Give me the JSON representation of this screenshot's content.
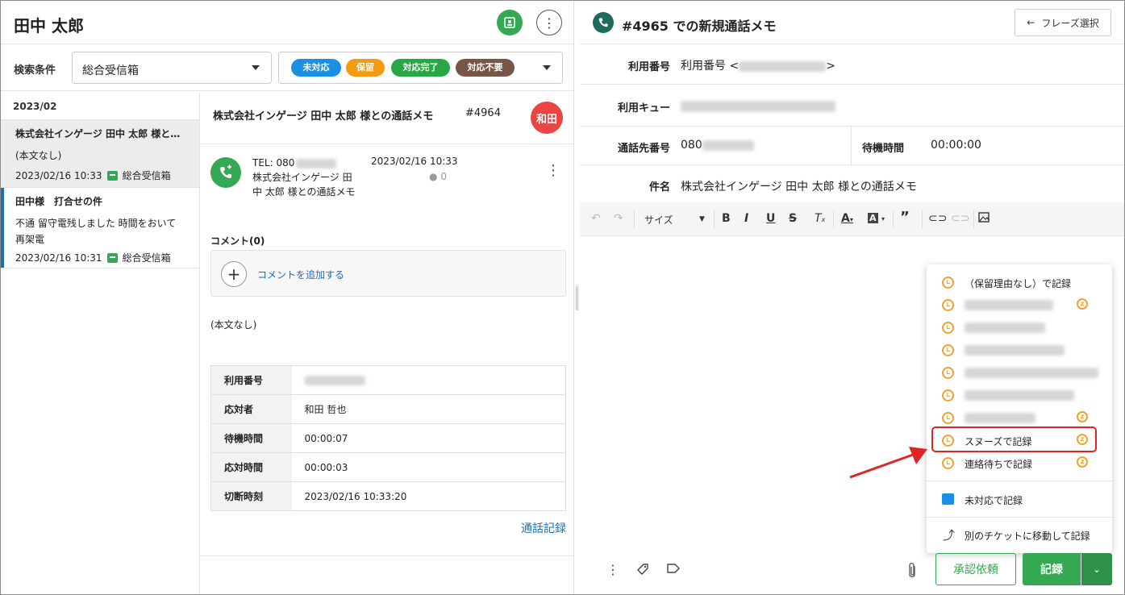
{
  "contact": {
    "name": "田中 太郎"
  },
  "filter": {
    "label": "検索条件",
    "inbox": "総合受信箱",
    "statuses": [
      {
        "label": "未対応",
        "color": "#1a8fe3"
      },
      {
        "label": "保留",
        "color": "#f39c12"
      },
      {
        "label": "対応完了",
        "color": "#27a845"
      },
      {
        "label": "対応不要",
        "color": "#795548"
      }
    ]
  },
  "ticket_list": {
    "month": "2023/02",
    "items": [
      {
        "title": "株式会社インゲージ 田中 太郎 様と…",
        "body": "(本文なし)",
        "date": "2023/02/16 10:33",
        "inbox": "総合受信箱"
      },
      {
        "title": "田中様　打合せの件",
        "body": "不通 留守電残しました 時間をおいて再架電",
        "date": "2023/02/16 10:31",
        "inbox": "総合受信箱"
      }
    ]
  },
  "detail": {
    "title": "株式会社インゲージ 田中 太郎 様との通話メモ",
    "number": "#4964",
    "assignee": "和田",
    "tel": "TEL: 080",
    "call_subject": "株式会社インゲージ 田中 太郎 様との通話メモ",
    "datetime": "2023/02/16 10:33",
    "comments_count": "0",
    "comment_label": "コメント(0)",
    "add_comment": "コメントを追加する",
    "body": "(本文なし)",
    "table": [
      {
        "key": "利用番号",
        "value": ""
      },
      {
        "key": "応対者",
        "value": "和田 哲也"
      },
      {
        "key": "待機時間",
        "value": "00:00:07"
      },
      {
        "key": "応対時間",
        "value": "00:00:03"
      },
      {
        "key": "切断時刻",
        "value": "2023/02/16 10:33:20"
      }
    ],
    "call_log": "通話記録"
  },
  "memo": {
    "title": "#4965 での新規通話メモ",
    "phrase_button": "フレーズ選択",
    "fields": {
      "number_label": "利用番号",
      "number_value_prefix": "利用番号 <",
      "number_value_suffix": ">",
      "queue_label": "利用キュー",
      "dest_label": "通話先番号",
      "dest_value": "080",
      "wait_label": "待機時間",
      "wait_value": "00:00:00",
      "subject_label": "件名",
      "subject_value": "株式会社インゲージ 田中 太郎 様との通話メモ"
    },
    "toolbar": {
      "size_label": "サイズ"
    }
  },
  "record_menu": {
    "items": [
      {
        "label": "（保留理由なし）で記録",
        "alarm": false
      },
      {
        "label": "",
        "alarm": true
      },
      {
        "label": "",
        "alarm": false
      },
      {
        "label": "",
        "alarm": false
      },
      {
        "label": "",
        "alarm": false
      },
      {
        "label": "",
        "alarm": false
      },
      {
        "label": "",
        "alarm": true
      },
      {
        "label": "スヌーズで記録",
        "alarm": true
      },
      {
        "label": "連絡待ちで記録",
        "alarm": true
      }
    ],
    "unhandled": "未対応で記録",
    "move": "別のチケットに移動して記録"
  },
  "footer": {
    "approval": "承認依頼",
    "record": "記録"
  }
}
